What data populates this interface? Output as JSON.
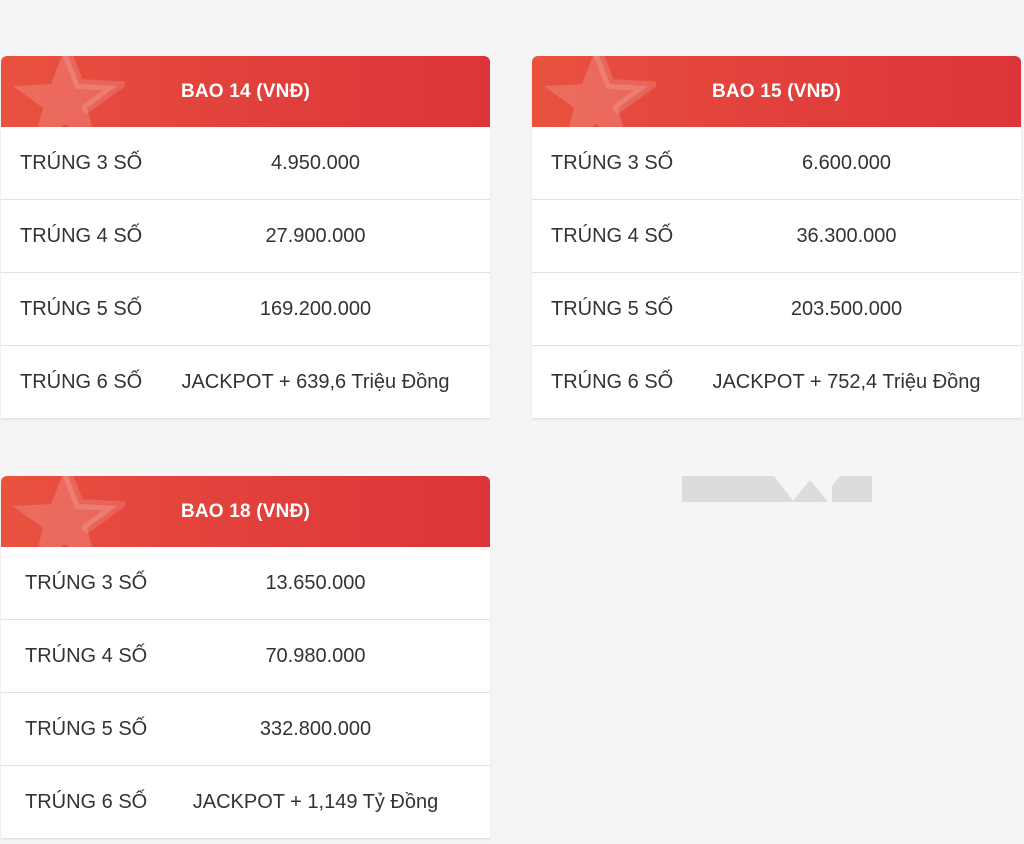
{
  "tables": [
    {
      "title": "BAO 14 (VNĐ)",
      "rows": [
        {
          "label": "TRÚNG 3 SỐ",
          "value": "4.950.000"
        },
        {
          "label": "TRÚNG 4 SỐ",
          "value": "27.900.000"
        },
        {
          "label": "TRÚNG 5 SỐ",
          "value": "169.200.000"
        },
        {
          "label": "TRÚNG 6 SỐ",
          "value": "JACKPOT + 639,6 Triệu Đồng"
        }
      ]
    },
    {
      "title": "BAO 15 (VNĐ)",
      "rows": [
        {
          "label": "TRÚNG 3 SỐ",
          "value": "6.600.000"
        },
        {
          "label": "TRÚNG 4 SỐ",
          "value": "36.300.000"
        },
        {
          "label": "TRÚNG 5 SỐ",
          "value": "203.500.000"
        },
        {
          "label": "TRÚNG 6 SỐ",
          "value": "JACKPOT + 752,4 Triệu Đồng"
        }
      ]
    },
    {
      "title": "BAO 18 (VNĐ)",
      "rows": [
        {
          "label": "TRÚNG 3 SỐ",
          "value": "13.650.000"
        },
        {
          "label": "TRÚNG 4 SỐ",
          "value": "70.980.000"
        },
        {
          "label": "TRÚNG 5 SỐ",
          "value": "332.800.000"
        },
        {
          "label": "TRÚNG 6 SỐ",
          "value": "JACKPOT + 1,149 Tỷ Đồng"
        }
      ]
    }
  ],
  "colors": {
    "header_red": "#e2423c",
    "row_divider": "#e2e2e2",
    "page_background": "#f5f5f5"
  },
  "icons": {
    "header_decoration": "star-icon",
    "placeholder": "logo-placeholder-icon"
  }
}
